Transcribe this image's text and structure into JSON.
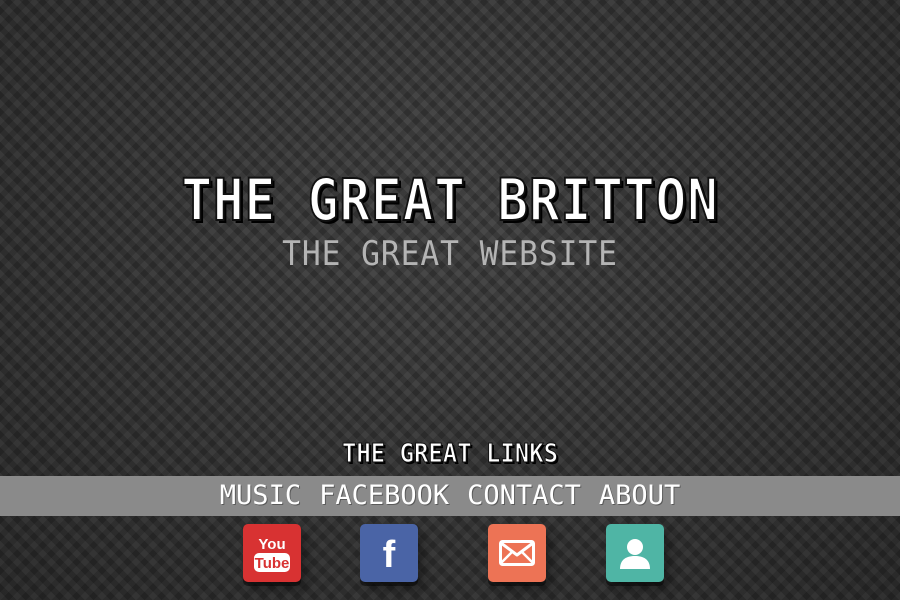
{
  "hero": {
    "title": "THE GREAT BRITTON",
    "subtitle": "THE GREAT WEBSITE"
  },
  "links": {
    "heading": "THE GREAT LINKS",
    "nav": [
      {
        "label": "MUSIC"
      },
      {
        "label": "FACEBOOK"
      },
      {
        "label": "CONTACT"
      },
      {
        "label": "ABOUT"
      }
    ]
  },
  "social": [
    {
      "icon": "youtube-icon",
      "color": "#d83232",
      "text_top": "You",
      "text_bottom": "Tube"
    },
    {
      "icon": "facebook-icon",
      "color": "#4a64a6",
      "letter": "f"
    },
    {
      "icon": "mail-icon",
      "color": "#ed7355"
    },
    {
      "icon": "user-icon",
      "color": "#4fb5a5"
    }
  ],
  "colors": {
    "background": "#3b3b3b",
    "nav_bar": "#8a8a8a",
    "title": "#ffffff",
    "subtitle": "#b4b4b4"
  }
}
